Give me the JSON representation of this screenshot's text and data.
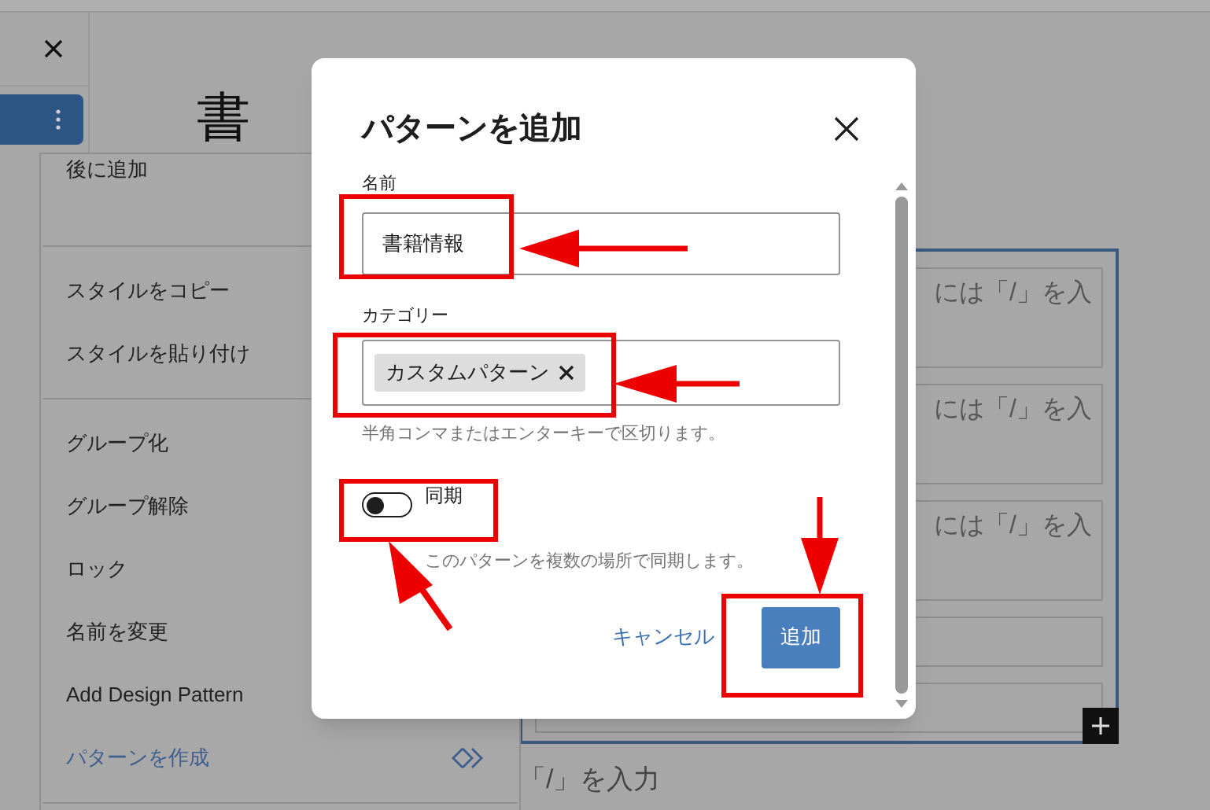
{
  "heading": "書",
  "context_menu": {
    "groups": [
      {
        "items": [
          {
            "label": "後に追加",
            "selected": false
          }
        ]
      },
      {
        "items": [
          {
            "label": "スタイルをコピー",
            "selected": false
          },
          {
            "label": "スタイルを貼り付け",
            "selected": false
          }
        ]
      },
      {
        "items": [
          {
            "label": "グループ化",
            "selected": false
          },
          {
            "label": "グループ解除",
            "selected": false
          },
          {
            "label": "ロック",
            "selected": false
          },
          {
            "label": "名前を変更",
            "selected": false
          },
          {
            "label": "Add Design Pattern",
            "selected": false
          },
          {
            "label": "パターンを作成",
            "selected": true
          }
        ]
      }
    ]
  },
  "editor": {
    "blocks": [
      {
        "placeholder": "には「/」を入"
      },
      {
        "placeholder": "には「/」を入"
      },
      {
        "placeholder": "には「/」を入"
      },
      {
        "kind": "blank"
      },
      {
        "kind": "blank"
      }
    ],
    "below_placeholder": "「/」を入力"
  },
  "dialog": {
    "title": "パターンを追加",
    "name_field": {
      "label": "名前",
      "value": "書籍情報"
    },
    "category_field": {
      "label": "カテゴリー",
      "tokens": [
        "カスタムパターン"
      ],
      "help": "半角コンマまたはエンターキーで区切ります。"
    },
    "sync_toggle": {
      "label": "同期",
      "on": false,
      "help": "このパターンを複数の場所で同期します。"
    },
    "buttons": {
      "cancel": "キャンセル",
      "add": "追加"
    }
  }
}
